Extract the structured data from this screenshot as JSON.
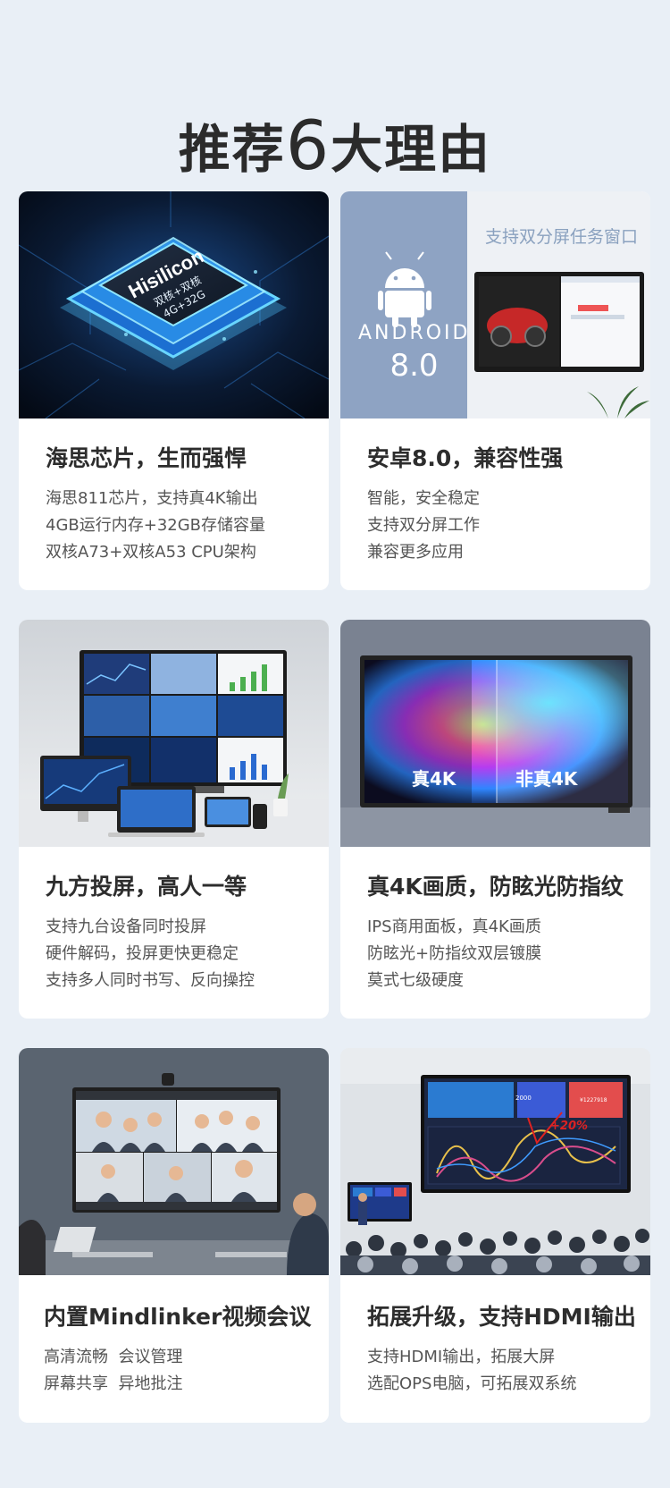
{
  "page": {
    "title_pre": "推荐",
    "title_num": "6",
    "title_post": "大理由"
  },
  "colors": {
    "background": "#e9eff6",
    "card": "#ffffff",
    "android_panel": "#8ea3c3",
    "caption": "#8aa1bf"
  },
  "cards": [
    {
      "title": "海思芯片，生而强悍",
      "lines": [
        "海思811芯片，支持真4K输出",
        "4GB运行内存+32GB存储容量",
        "双核A73+双核A53 CPU架构"
      ],
      "image": {
        "chip_brand": "Hisilicon",
        "chip_spec": "双核+双核",
        "chip_mem": "4G+32G"
      }
    },
    {
      "title": "安卓8.0，兼容性强",
      "lines": [
        "智能，安全稳定",
        "支持双分屏工作",
        "兼容更多应用"
      ],
      "image": {
        "android_word": "ANDROID",
        "android_version": "8.0",
        "caption": "支持双分屏任务窗口"
      }
    },
    {
      "title": "九方投屏，高人一等",
      "lines": [
        "支持九台设备同时投屏",
        "硬件解码，投屏更快更稳定",
        "支持多人同时书写、反向操控"
      ]
    },
    {
      "title": "真4K画质，防眩光防指纹",
      "lines": [
        "IPS商用面板，真4K画质",
        "防眩光+防指纹双层镀膜",
        "莫式七级硬度"
      ],
      "image": {
        "label_left": "真4K",
        "label_right": "非真4K"
      }
    },
    {
      "title": "内置Mindlinker视频会议",
      "lines": [
        "高清流畅  会议管理",
        "屏幕共享  异地批注"
      ]
    },
    {
      "title": "拓展升级，支持HDMI输出",
      "lines": [
        "支持HDMI输出，拓展大屏",
        "选配OPS电脑，可拓展双系统"
      ],
      "image": {
        "kpi_1": "2000",
        "kpi_2": "¥1227918",
        "annotation": "+20%"
      }
    }
  ]
}
